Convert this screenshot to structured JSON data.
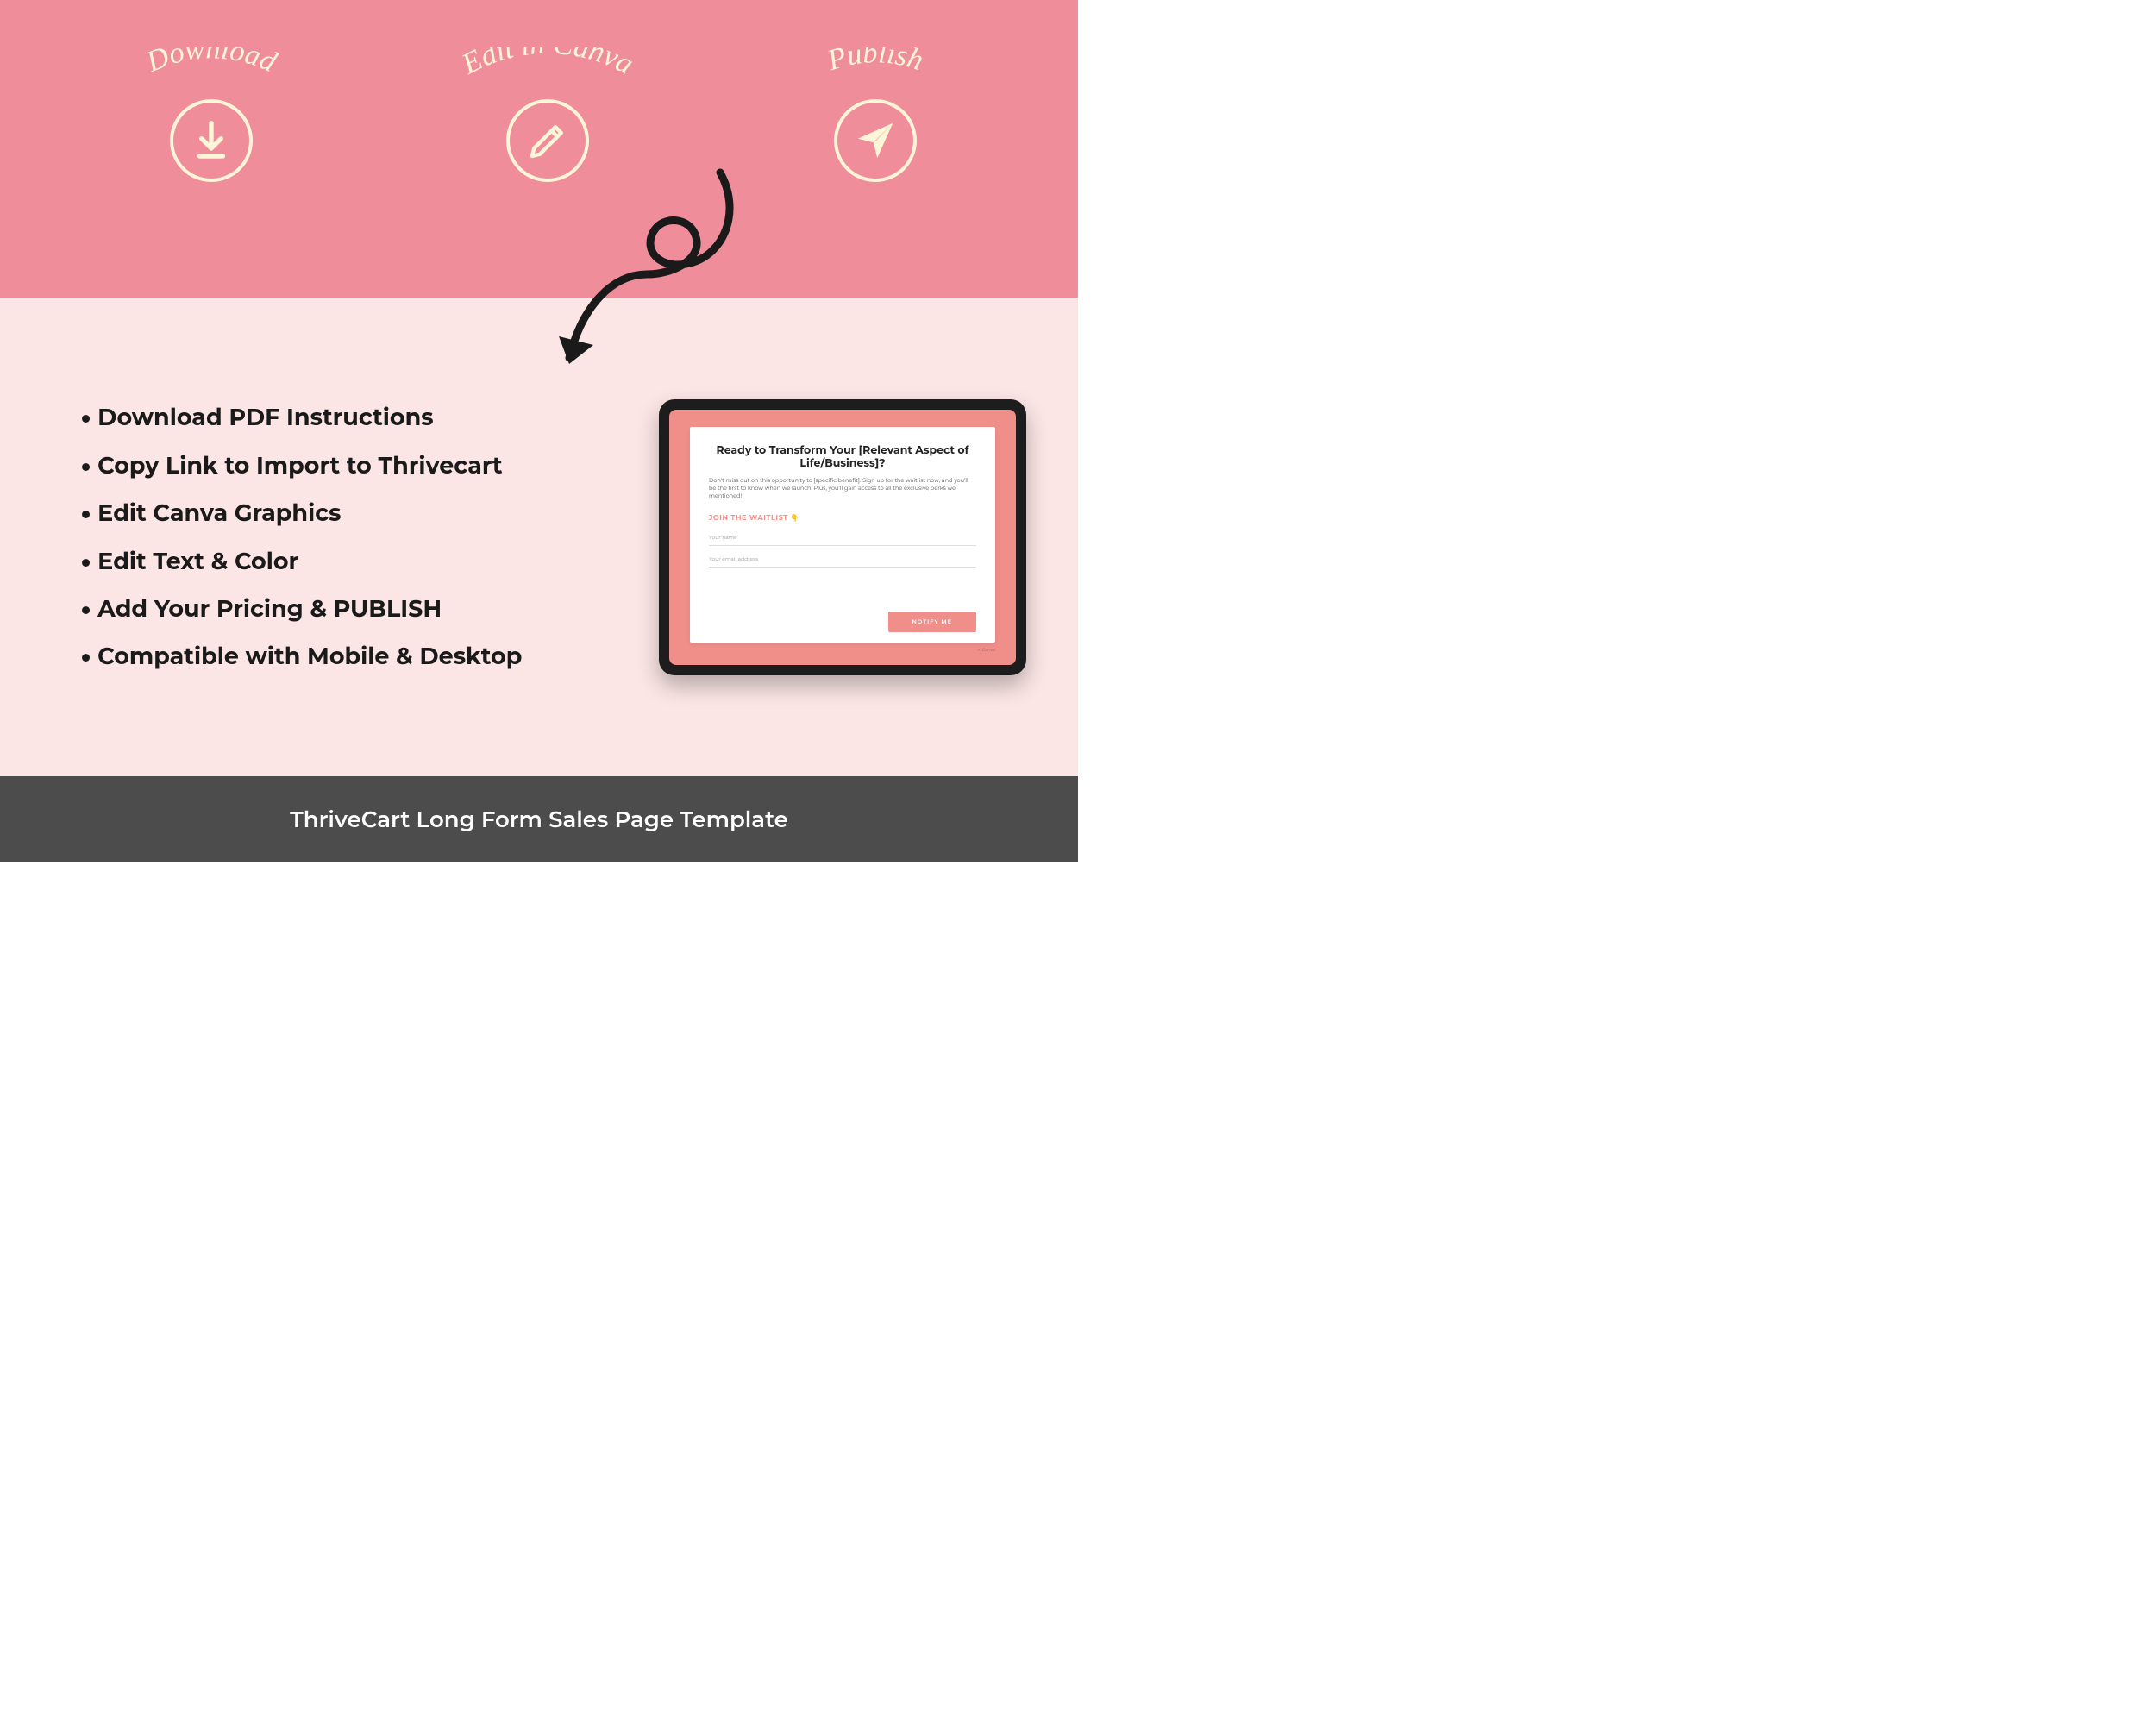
{
  "hero": {
    "steps": [
      {
        "label": "Download",
        "icon": "download-icon"
      },
      {
        "label": "Edit in Canva",
        "icon": "pencil-icon"
      },
      {
        "label": "Publish",
        "icon": "paper-plane-icon"
      }
    ]
  },
  "features": {
    "items": [
      "Download PDF Instructions",
      "Copy Link to Import to Thrivecart",
      "Edit Canva Graphics",
      "Edit Text & Color",
      "Add Your Pricing & PUBLISH",
      "Compatible with Mobile & Desktop"
    ]
  },
  "tablet": {
    "heading": "Ready to Transform Your [Relevant Aspect of Life/Business]?",
    "sub": "Don't miss out on this opportunity to [specific benefit]. Sign up for the waitlist now, and you'll be the first to know when we launch. Plus, you'll gain access to all the exclusive perks we mentioned!",
    "cta": "JOIN THE WAITLIST 👇",
    "name_placeholder": "Your name",
    "email_placeholder": "Your email address",
    "button": "NOTIFY ME",
    "footer_credit": "✓ Canva"
  },
  "footer": {
    "text": "ThriveCart Long Form Sales Page Template"
  }
}
